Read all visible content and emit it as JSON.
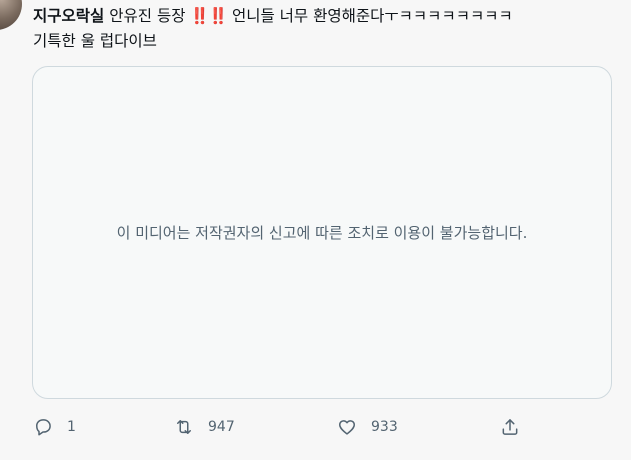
{
  "tweet": {
    "author": "지구오락실",
    "text_line1": " 안유진 등장",
    "emoji": "‼️‼️",
    "text_line1_rest": " 언니들 너무 환영해준다ㅜㅋㅋㅋㅋㅋㅋㅋㅋ",
    "text_line2": "기특한 울 럽다이브"
  },
  "media": {
    "notice": "이 미디어는 저작권자의 신고에 따른 조치로 이용이 불가능합니다."
  },
  "actions": {
    "reply_icon": "reply-icon",
    "reply_count": "1",
    "retweet_icon": "retweet-icon",
    "retweet_count": "947",
    "like_icon": "heart-icon",
    "like_count": "933",
    "share_icon": "share-icon"
  },
  "colors": {
    "background": "#f7f7f7",
    "text": "#0f1419",
    "secondary": "#536471",
    "border": "#cfd9de",
    "emoji_red": "#d6263a"
  }
}
